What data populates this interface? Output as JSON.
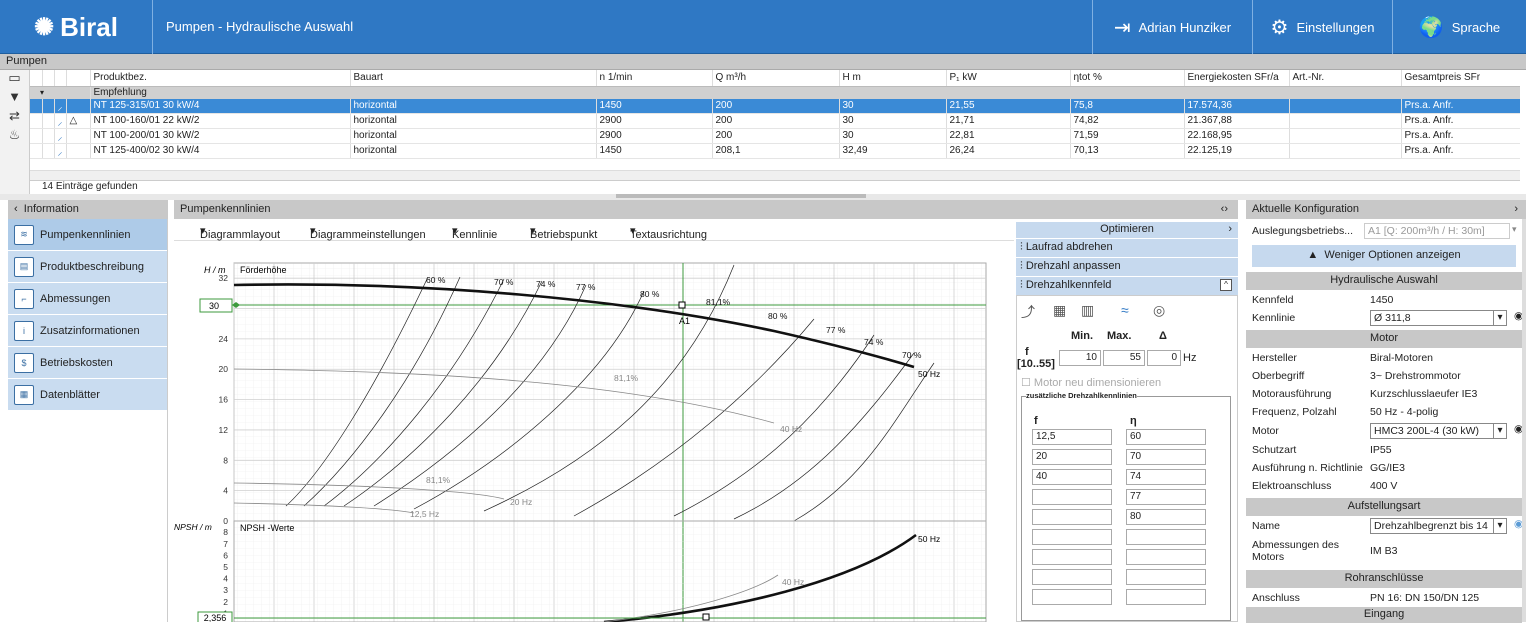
{
  "header": {
    "brand": "Biral",
    "app_title": "Pumpen - Hydraulische Auswahl",
    "user": "Adrian Hunziker",
    "settings": "Einstellungen",
    "language": "Sprache"
  },
  "pumps": {
    "section_title": "Pumpen",
    "columns": [
      "Produktbez.",
      "Bauart",
      "n 1/min",
      "Q m³/h",
      "H m",
      "P₁ kW",
      "ηtot %",
      "Energiekosten SFr/a",
      "Art.-Nr.",
      "Gesamtpreis SFr"
    ],
    "group_label": "Empfehlung",
    "rows": [
      [
        "NT 125-315/01 30 kW/4",
        "horizontal",
        "1450",
        "200",
        "30",
        "21,55",
        "75,8",
        "17.574,36",
        "",
        "Prs.a. Anfr."
      ],
      [
        "NT 100-160/01 22 kW/2",
        "horizontal",
        "2900",
        "200",
        "30",
        "21,71",
        "74,82",
        "21.367,88",
        "",
        "Prs.a. Anfr."
      ],
      [
        "NT 100-200/01 30 kW/2",
        "horizontal",
        "2900",
        "200",
        "30",
        "22,81",
        "71,59",
        "22.168,95",
        "",
        "Prs.a. Anfr."
      ],
      [
        "NT 125-400/02 30 kW/4",
        "horizontal",
        "1450",
        "208,1",
        "32,49",
        "26,24",
        "70,13",
        "22.125,19",
        "",
        "Prs.a. Anfr."
      ]
    ],
    "found_text": "14 Einträge gefunden"
  },
  "left_panel": {
    "title": "Information",
    "items": [
      "Pumpenkennlinien",
      "Produktbeschreibung",
      "Abmessungen",
      "Zusatzinformationen",
      "Betriebskosten",
      "Datenblätter"
    ]
  },
  "center": {
    "title": "Pumpenkennlinien",
    "menu": [
      "Diagrammlayout",
      "Diagrammeinstellungen",
      "Kennlinie",
      "Betriebspunkt",
      "Textausrichtung"
    ]
  },
  "chart_data": {
    "type": "line",
    "top": {
      "ylabel": "H / m",
      "legend": "Förderhöhe",
      "yticks": [
        0,
        4,
        8,
        12,
        16,
        20,
        24,
        28,
        32
      ],
      "ylim": [
        0,
        34
      ],
      "marker_value": "30",
      "operating_point": "A1",
      "curve_labels": [
        "50 Hz",
        "40 Hz",
        "20 Hz",
        "12,5 Hz"
      ],
      "efficiency_labels": [
        "60 %",
        "70 %",
        "74 %",
        "77 %",
        "80 %",
        "81,1%",
        "80 %",
        "77 %",
        "74 %",
        "70 %",
        "81,1%",
        "81,1%"
      ]
    },
    "bottom": {
      "ylabel": "NPSH / m",
      "legend": "NPSH -Werte",
      "yticks": [
        0,
        1,
        2,
        3,
        4,
        5,
        6,
        7,
        8
      ],
      "marker_value": "2,356",
      "curve_labels": [
        "50 Hz",
        "40 Hz"
      ]
    }
  },
  "optimize": {
    "title": "Optimieren",
    "items": [
      "Laufrad abdrehen",
      "Drehzahl anpassen",
      "Drehzahlkennfeld"
    ],
    "min_label": "Min.",
    "max_label": "Max.",
    "delta_label": "Δ",
    "f_label": "f",
    "f_range": "[10..55]",
    "f_min": "10",
    "f_max": "55",
    "f_delta": "0",
    "unit": "Hz",
    "checkbox": "Motor neu dimensionieren",
    "group_title": "zusätzliche Drehzahlkennlinien",
    "col_f": "f",
    "col_eta": "η",
    "f_values": [
      "12,5",
      "20",
      "40",
      "",
      "",
      "",
      "",
      "",
      ""
    ],
    "eta_values": [
      "60",
      "70",
      "74",
      "77",
      "80",
      "",
      "",
      "",
      ""
    ]
  },
  "config": {
    "title": "Aktuelle Konfiguration",
    "auslegung_label": "Auslegungsbetriebs...",
    "auslegung_value": "A1 [Q: 200m³/h / H: 30m]",
    "less_options": "Weniger Optionen anzeigen",
    "sec_hydraulic": "Hydraulische Auswahl",
    "kennfeld_label": "Kennfeld",
    "kennfeld_value": "1450",
    "kennlinie_label": "Kennlinie",
    "kennlinie_value": "Ø 311,8",
    "sec_motor": "Motor",
    "hersteller_label": "Hersteller",
    "hersteller_value": "Biral-Motoren",
    "oberbegriff_label": "Oberbegriff",
    "oberbegriff_value": "3~ Drehstrommotor",
    "motorausf_label": "Motorausführung",
    "motorausf_value": "Kurzschlusslaeufer IE3",
    "frequenz_label": "Frequenz, Polzahl",
    "frequenz_value": "50 Hz - 4-polig",
    "motor_label": "Motor",
    "motor_value": "HMC3 200L-4 (30 kW)",
    "schutzart_label": "Schutzart",
    "schutzart_value": "IP55",
    "richtlinie_label": "Ausführung n. Richtlinie",
    "richtlinie_value": "GG/IE3",
    "elektro_label": "Elektroanschluss",
    "elektro_value": "400 V",
    "sec_aufstellung": "Aufstellungsart",
    "name_label": "Name",
    "name_value": "Drehzahlbegrenzt bis 14",
    "abmessungen_label": "Abmessungen des Motors",
    "abmessungen_value": "IM B3",
    "sec_rohr": "Rohranschlüsse",
    "anschluss_label": "Anschluss",
    "anschluss_value": "PN 16: DN 150/DN 125",
    "sec_eingang": "Eingang"
  }
}
